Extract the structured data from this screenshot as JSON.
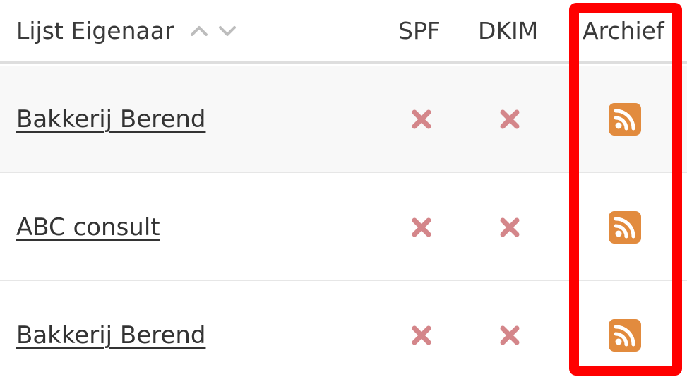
{
  "table": {
    "columns": {
      "owner": "Lijst Eigenaar",
      "spf": "SPF",
      "dkim": "DKIM",
      "archive": "Archief"
    },
    "sort_icons": [
      "chevron-up-icon",
      "chevron-down-icon"
    ],
    "rows": [
      {
        "owner": "Bakkerij Berend",
        "spf": false,
        "dkim": false,
        "archive_icon": "rss-icon"
      },
      {
        "owner": "ABC consult",
        "spf": false,
        "dkim": false,
        "archive_icon": "rss-icon"
      },
      {
        "owner": "Bakkerij Berend",
        "spf": false,
        "dkim": false,
        "archive_icon": "rss-icon"
      }
    ]
  },
  "colors": {
    "x_mark": "#d4868a",
    "rss": "#e28b3e",
    "highlight": "#ff0000",
    "header_border": "#dedede",
    "striped_row": "#f8f8f8"
  }
}
